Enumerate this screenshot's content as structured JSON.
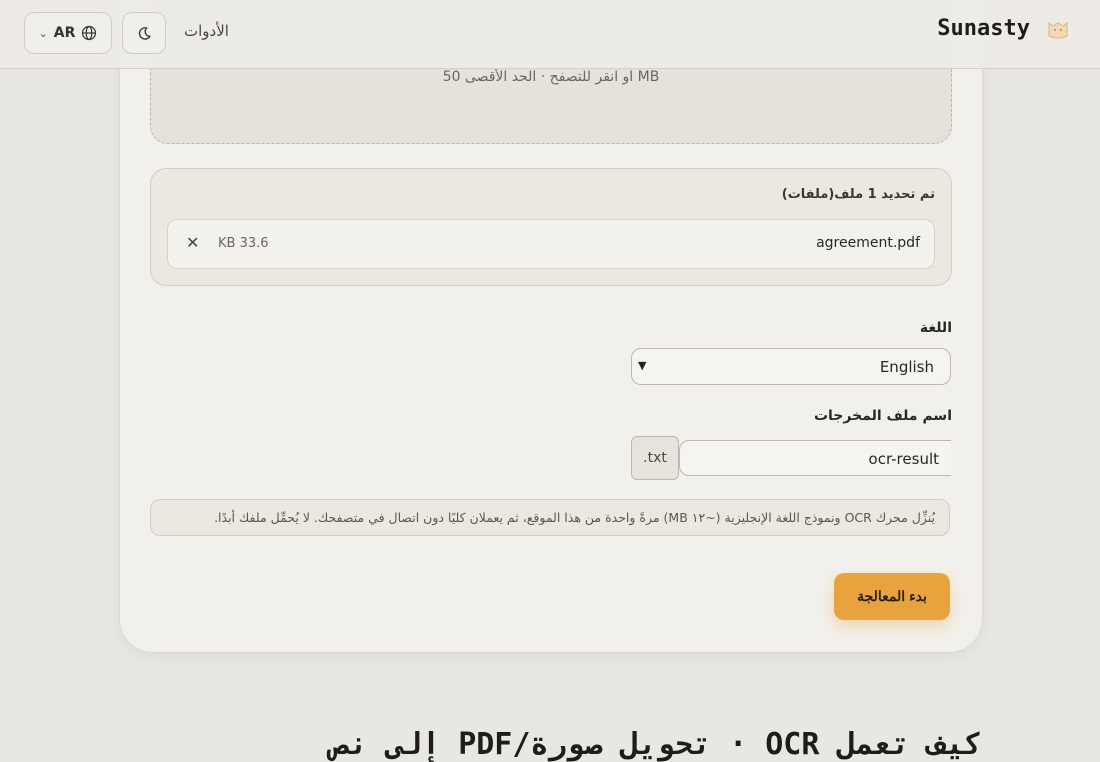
{
  "header": {
    "brand": "Sunasty",
    "tools_link": "الأدوات",
    "language_code": "AR"
  },
  "upload": {
    "hint": "او انقر للتصفح · الحد الأقصى 50 MB"
  },
  "files": {
    "title": "تم تحديد 1 ملف(ملفات)",
    "items": [
      {
        "name": "agreement.pdf",
        "size": "33.6 KB"
      }
    ]
  },
  "language": {
    "label": "اللغة",
    "selected": "English"
  },
  "output": {
    "label": "اسم ملف المخرجات",
    "value": "ocr-result",
    "extension": ".txt"
  },
  "note": "يُنزِّل محرك OCR ونموذج اللغة الإنجليزية (~١٢ MB) مرةً واحدة من هذا الموقع، ثم يعملان كليًا دون اتصال في متصفحك. لا يُحمِّل ملفك أبدًا.",
  "actions": {
    "start_label": "بدء المعالجة"
  },
  "section": {
    "heading": "كيف تعمل OCR · تحويل صورة/PDF إلى نص"
  },
  "colors": {
    "accent": "#e9a33e",
    "page_bg": "#e9e7e2",
    "card_bg": "#f2f0eb"
  }
}
